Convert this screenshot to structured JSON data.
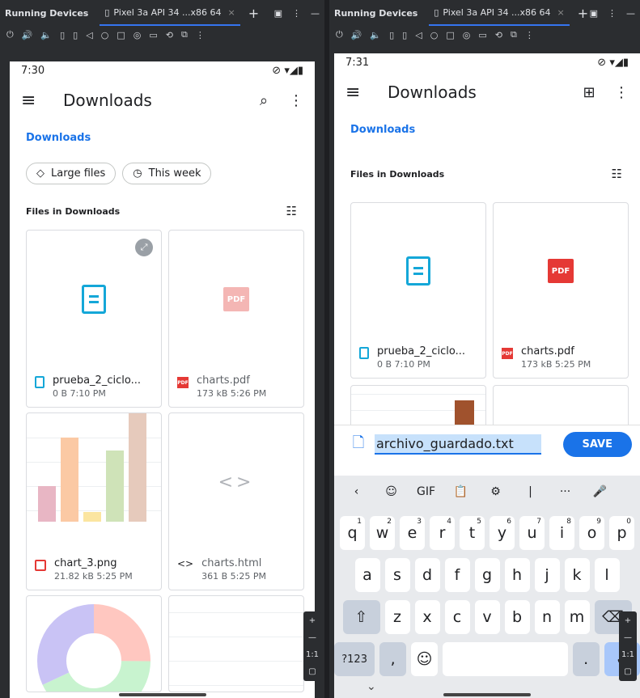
{
  "ide": {
    "tool_title": "Running Devices",
    "device_tab": "Pixel 3a API 34 ...x86 64",
    "tab_close": "×",
    "add_tab": "+",
    "right_icons": [
      "▣",
      "⋮",
      "—"
    ]
  },
  "toolbar_icons": [
    "⏻",
    "🔊",
    "🔈",
    "▯",
    "▯",
    "◁",
    "○",
    "□",
    "◎",
    "▭",
    "⟲",
    "⧉",
    "⋮"
  ],
  "left": {
    "time": "7:30",
    "status_icons": "⊘ ▾◢▮",
    "title": "Downloads",
    "breadcrumb": "Downloads",
    "chips": [
      {
        "icon": "◇",
        "label": "Large files"
      },
      {
        "icon": "◷",
        "label": "This week"
      }
    ],
    "section_title": "Files in Downloads",
    "files": [
      {
        "name": "prueba_2_ciclo...",
        "meta": "0 B 7:10 PM"
      },
      {
        "name": "charts.pdf",
        "meta": "173 kB 5:26 PM"
      },
      {
        "name": "chart_3.png",
        "meta": "21.82 kB 5:25 PM"
      },
      {
        "name": "charts.html",
        "meta": "361 B 5:25 PM"
      }
    ],
    "side_controls": [
      "+",
      "—",
      "1:1",
      "▢"
    ]
  },
  "right": {
    "time": "7:31",
    "status_icons": "⊘ ▾◢▮",
    "title": "Downloads",
    "breadcrumb": "Downloads",
    "section_title": "Files in Downloads",
    "files": [
      {
        "name": "prueba_2_ciclo...",
        "meta": "0 B 7:10 PM"
      },
      {
        "name": "charts.pdf",
        "meta": "173 kB 5:25 PM"
      }
    ],
    "filename_value": "archivo_guardado.txt",
    "save_label": "SAVE",
    "kb_suggestions": [
      "‹",
      "☺",
      "GIF",
      "📋",
      "⚙",
      "|",
      "···",
      "🎤"
    ],
    "row1": [
      {
        "k": "q",
        "n": "1"
      },
      {
        "k": "w",
        "n": "2"
      },
      {
        "k": "e",
        "n": "3"
      },
      {
        "k": "r",
        "n": "4"
      },
      {
        "k": "t",
        "n": "5"
      },
      {
        "k": "y",
        "n": "6"
      },
      {
        "k": "u",
        "n": "7"
      },
      {
        "k": "i",
        "n": "8"
      },
      {
        "k": "o",
        "n": "9"
      },
      {
        "k": "p",
        "n": "0"
      }
    ],
    "row2": [
      "a",
      "s",
      "d",
      "f",
      "g",
      "h",
      "j",
      "k",
      "l"
    ],
    "row3": [
      "z",
      "x",
      "c",
      "v",
      "b",
      "n",
      "m"
    ],
    "shift": "⇧",
    "backspace": "⌫",
    "sym": "?123",
    "comma": ",",
    "emoji": "☺",
    "period": ".",
    "enter": "✓",
    "collapse": "⌄",
    "side_controls": [
      "+",
      "—",
      "1:1",
      "▢"
    ]
  },
  "pdf_label": "PDF",
  "code_glyph": "<>",
  "colors": {
    "accent": "#1a73e8",
    "doc": "#14a7d8",
    "pdf": "#e53935"
  }
}
